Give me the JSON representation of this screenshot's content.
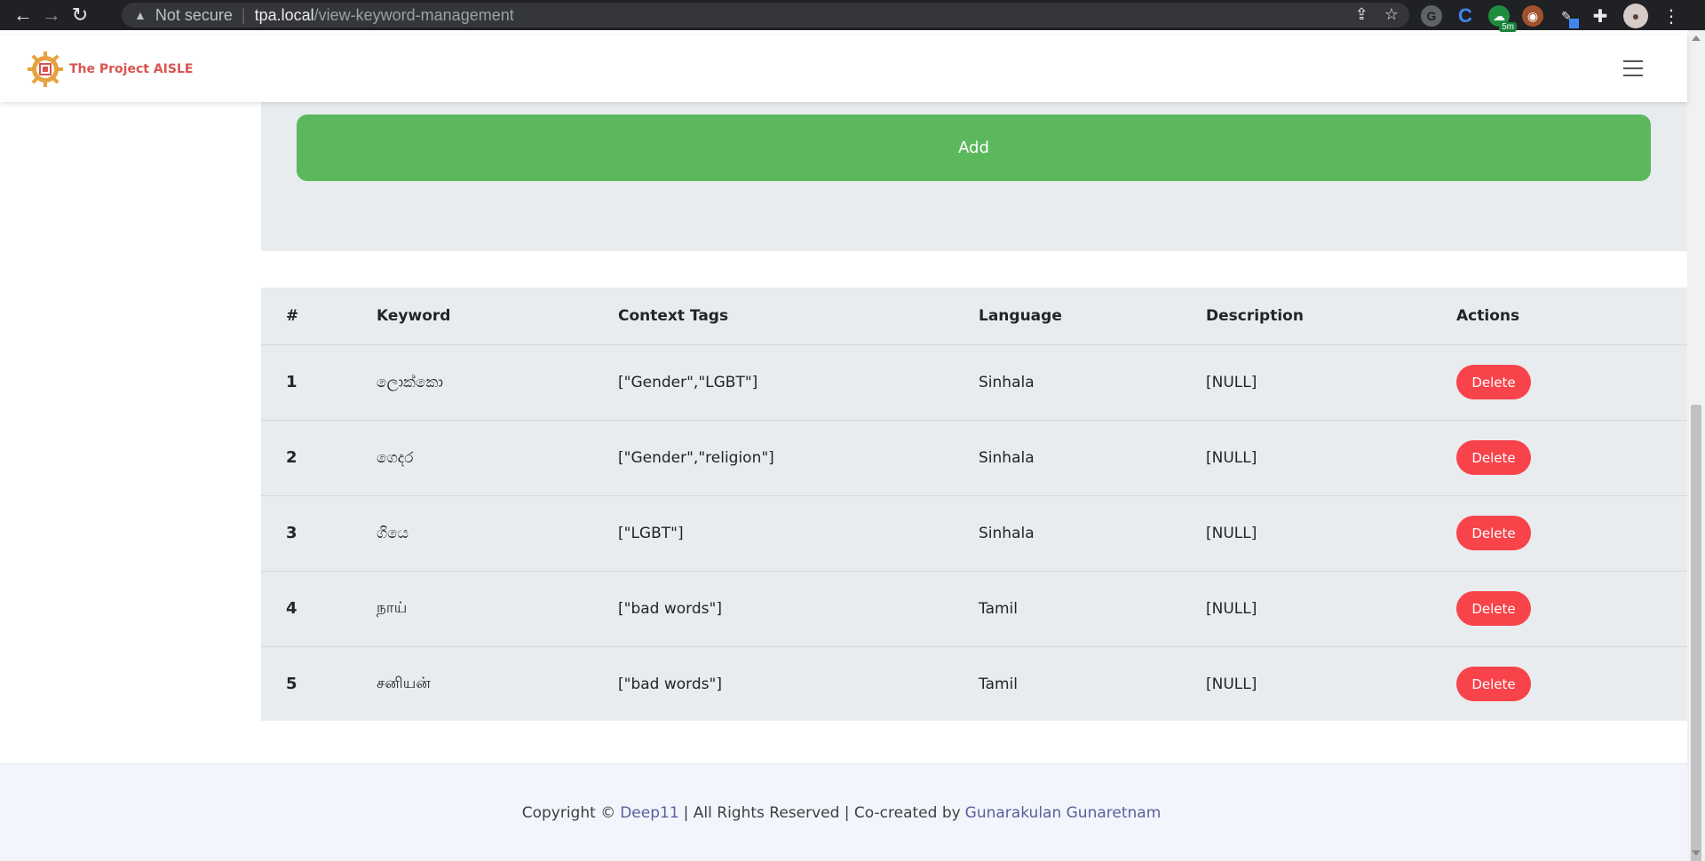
{
  "browser": {
    "back_icon": "←",
    "forward_icon": "→",
    "reload_icon": "↻",
    "security_label": "Not secure",
    "url_host": "tpa.local",
    "url_path": "/view-keyword-management",
    "extension_badge": "5m"
  },
  "header": {
    "logo_text": "The Project AISLE"
  },
  "form": {
    "add_label": "Add"
  },
  "table": {
    "columns": [
      "#",
      "Keyword",
      "Context Tags",
      "Language",
      "Description",
      "Actions"
    ],
    "rows": [
      {
        "num": "1",
        "keyword": "ලොක්කො",
        "tags": "[\"Gender\",\"LGBT\"]",
        "language": "Sinhala",
        "description": "[NULL]",
        "action": "Delete"
      },
      {
        "num": "2",
        "keyword": "ගෙදර",
        "tags": "[\"Gender\",\"religion\"]",
        "language": "Sinhala",
        "description": "[NULL]",
        "action": "Delete"
      },
      {
        "num": "3",
        "keyword": "ගියෙ",
        "tags": "[\"LGBT\"]",
        "language": "Sinhala",
        "description": "[NULL]",
        "action": "Delete"
      },
      {
        "num": "4",
        "keyword": "நாய்",
        "tags": "[\"bad words\"]",
        "language": "Tamil",
        "description": "[NULL]",
        "action": "Delete"
      },
      {
        "num": "5",
        "keyword": "சனியன்",
        "tags": "[\"bad words\"]",
        "language": "Tamil",
        "description": "[NULL]",
        "action": "Delete"
      }
    ]
  },
  "footer": {
    "copyright_prefix": "Copyright ©",
    "company": "Deep11",
    "rights": "| All Rights Reserved | Co-created by",
    "author": "Gunarakulan Gunaretnam"
  },
  "colors": {
    "add_button": "#5cb85c",
    "delete_button": "#f8434a",
    "card_bg": "#e9ecef",
    "footer_link": "#5a5f9c",
    "logo_text": "#d9534f"
  }
}
